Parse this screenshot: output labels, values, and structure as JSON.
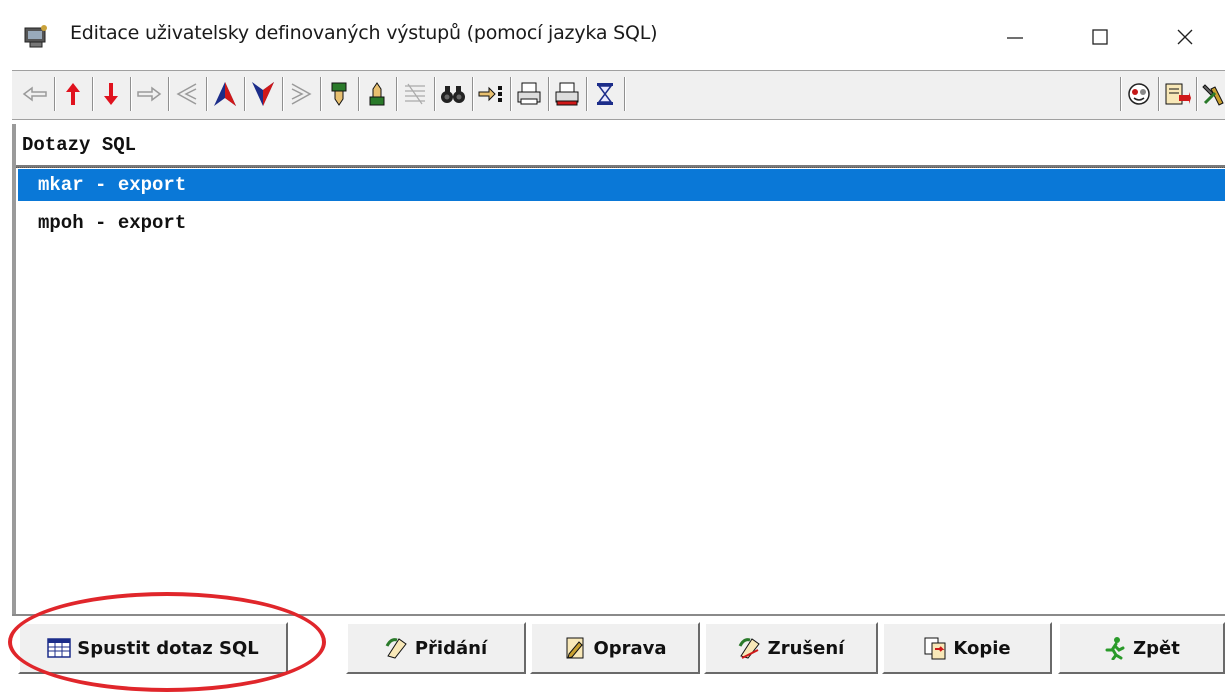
{
  "window": {
    "title": "Editace uživatelsky definovaných výstupů (pomocí jazyka SQL)",
    "controls": {
      "minimize": "—",
      "maximize": "☐",
      "close": "✕"
    }
  },
  "toolbar": {
    "icons": [
      "arrow-left-outline-icon",
      "arrow-up-red-icon",
      "arrow-down-red-icon",
      "arrow-right-outline-icon",
      "arrow-first-outline-icon",
      "arrow-top-blue-icon",
      "arrow-bottom-blue-icon",
      "arrow-last-outline-icon",
      "pointer-down-icon",
      "pointer-up-icon",
      "filter-disabled-icon",
      "binoculars-icon",
      "pointer-list-icon",
      "printer-icon",
      "printer-red-icon",
      "hourglass-icon",
      "help-face-icon",
      "export-icon",
      "settings-tools-icon"
    ]
  },
  "list": {
    "header": "Dotazy SQL",
    "rows": [
      {
        "label": "mkar - export",
        "selected": true
      },
      {
        "label": "mpoh - export",
        "selected": false
      }
    ]
  },
  "buttons": {
    "run": "Spustit dotaz SQL",
    "add": "Přidání",
    "edit": "Oprava",
    "delete": "Zrušení",
    "copy": "Kopie",
    "back": "Zpět"
  },
  "colors": {
    "selection": "#0a78d7",
    "highlight_oval": "#e0262b",
    "toolbar_bg": "#f0f0f0"
  }
}
